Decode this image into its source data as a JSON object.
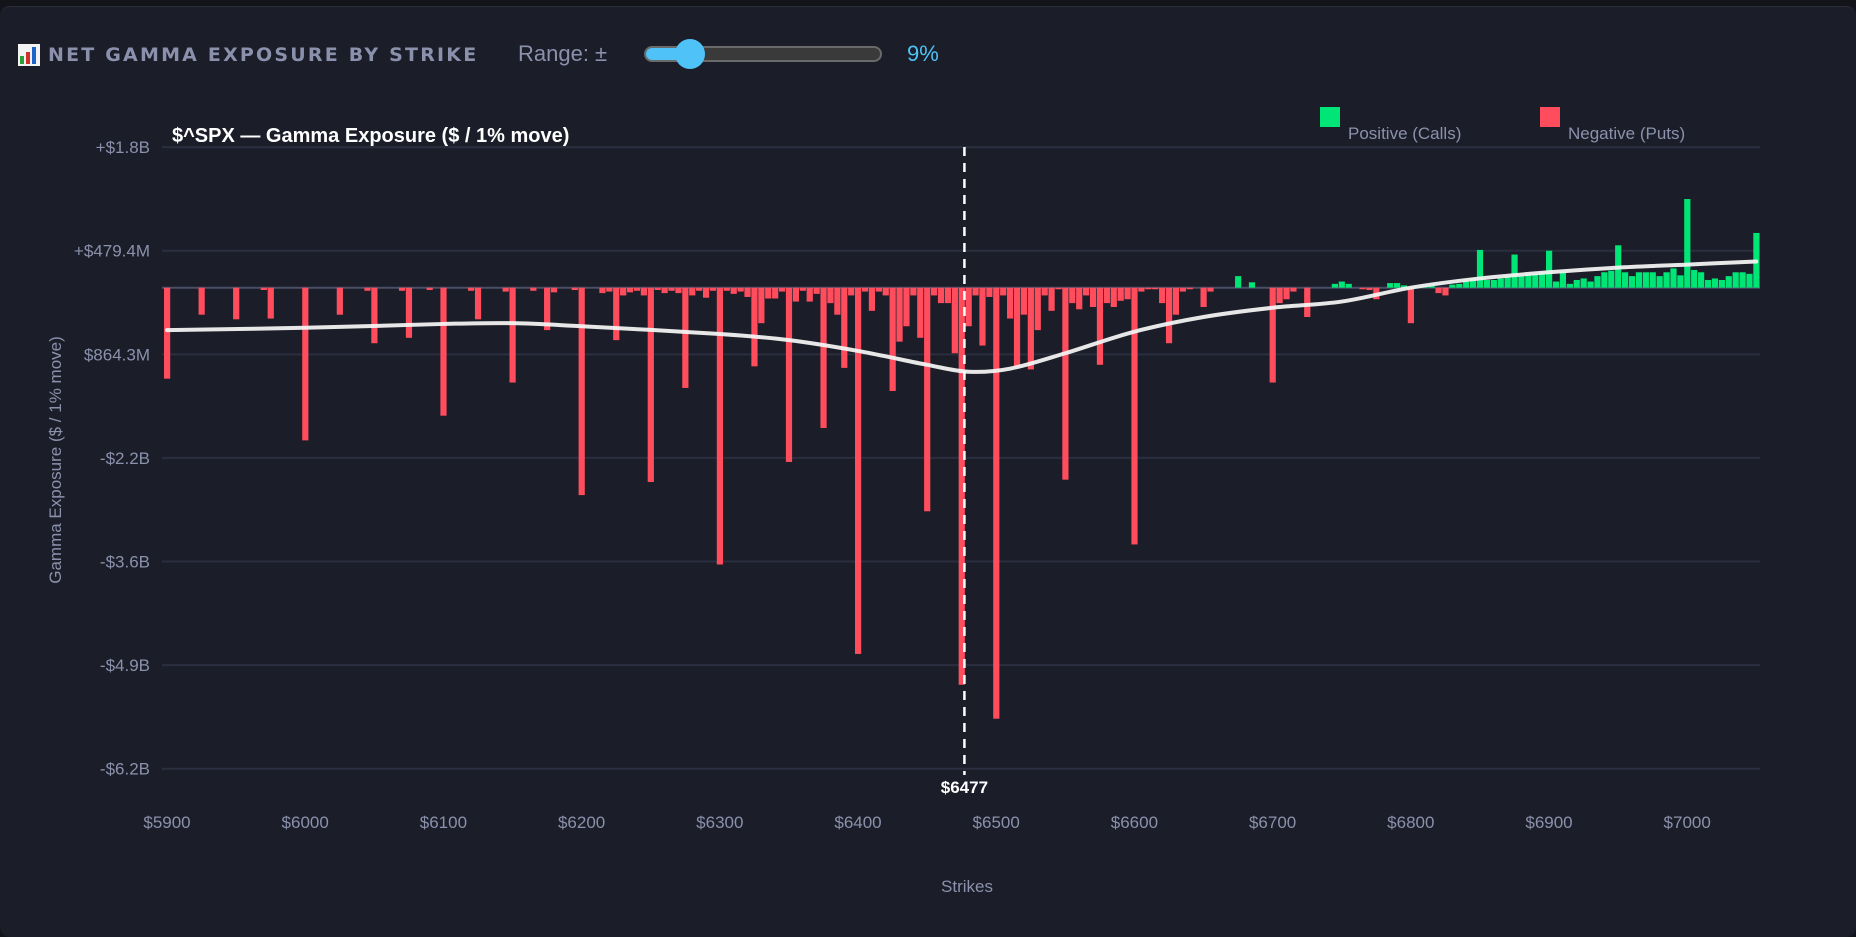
{
  "header": {
    "icon": "bar-chart-icon",
    "title": "NET GAMMA EXPOSURE BY STRIKE",
    "range_label": "Range: ±",
    "range_value_text": "9%",
    "range_value": 9,
    "slider_fill_fraction": 0.19
  },
  "colors": {
    "positive": "#00e676",
    "negative": "#ff4d5e",
    "trend": "#f2f2f2",
    "accent": "#4fc3f7",
    "background": "#1b1e28"
  },
  "chart_data": {
    "type": "bar",
    "title": "$^SPX — Gamma Exposure ($ / 1% move)",
    "xlabel": "Strikes",
    "ylabel": "Gamma Exposure ($ / 1% move)",
    "legend": [
      {
        "name": "Positive (Calls)",
        "color": "#00e676"
      },
      {
        "name": "Negative (Puts)",
        "color": "#ff4d5e"
      }
    ],
    "legend_position": "top-right",
    "units": "billions USD",
    "strike_start": 5900,
    "strike_step": 5,
    "xlim": [
      5900,
      7050
    ],
    "ylim": [
      -6.239,
      1.823
    ],
    "grid": true,
    "x_ticks": [
      5900,
      6000,
      6100,
      6200,
      6300,
      6400,
      6500,
      6600,
      6700,
      6800,
      6900,
      7000
    ],
    "x_tick_labels": [
      "$5900",
      "$6000",
      "$6100",
      "$6200",
      "$6300",
      "$6400",
      "$6500",
      "$6600",
      "$6700",
      "$6800",
      "$6900",
      "$7000"
    ],
    "y_ticks": [
      1.823,
      0.4794,
      -0.8643,
      -2.208,
      -3.552,
      -4.895,
      -6.239
    ],
    "y_tick_labels": [
      "+$1.8B",
      "+$479.4M",
      "$864.3M",
      "-$2.2B",
      "-$3.6B",
      "-$4.9B",
      "-$6.2B"
    ],
    "spot": {
      "value": 6477,
      "label": "$6477"
    },
    "values": [
      -1.18,
      0,
      0,
      0,
      0,
      -0.35,
      0,
      0,
      0,
      0,
      -0.41,
      0,
      0,
      0,
      -0.03,
      -0.4,
      0,
      0,
      0,
      0,
      -1.98,
      0,
      0,
      0,
      0,
      -0.35,
      0,
      0,
      0,
      -0.04,
      -0.72,
      0,
      0,
      0,
      -0.04,
      -0.65,
      0,
      0,
      -0.03,
      0,
      -1.66,
      0,
      0,
      0,
      -0.04,
      -0.41,
      0,
      0,
      0,
      -0.05,
      -1.23,
      0,
      0,
      -0.04,
      0,
      -0.55,
      -0.06,
      0,
      0,
      -0.03,
      -2.69,
      0,
      0,
      -0.07,
      -0.05,
      -0.68,
      -0.1,
      -0.06,
      -0.04,
      -0.1,
      -2.52,
      -0.03,
      -0.07,
      -0.04,
      -0.07,
      -1.3,
      -0.1,
      -0.04,
      -0.13,
      -0.04,
      -3.59,
      -0.04,
      -0.08,
      -0.05,
      -0.12,
      -1.02,
      -0.46,
      -0.14,
      -0.14,
      -0.05,
      -2.26,
      -0.18,
      -0.04,
      -0.18,
      -0.08,
      -1.82,
      -0.2,
      -0.35,
      -1.04,
      -0.1,
      -4.75,
      -0.05,
      -0.3,
      -0.05,
      -0.1,
      -1.34,
      -0.7,
      -0.5,
      -0.1,
      -0.65,
      -2.9,
      -0.1,
      -0.2,
      -0.2,
      -0.85,
      -5.15,
      -0.5,
      -0.1,
      -0.75,
      -0.12,
      -5.59,
      -0.1,
      -0.4,
      -1.02,
      -0.35,
      -1.06,
      -0.55,
      -0.1,
      -0.3,
      -0.02,
      -2.49,
      -0.2,
      -0.28,
      -0.1,
      -0.25,
      -1.0,
      -0.2,
      -0.25,
      -0.17,
      -0.15,
      -3.33,
      -0.05,
      -0.02,
      -0.02,
      -0.2,
      -0.72,
      -0.35,
      -0.05,
      -0.02,
      0,
      -0.25,
      -0.05,
      0,
      0,
      0,
      0.15,
      0,
      0.07,
      0,
      0,
      -1.23,
      -0.2,
      -0.15,
      -0.05,
      0,
      -0.38,
      0,
      0,
      0,
      0.05,
      0.08,
      0.05,
      0,
      -0.02,
      -0.03,
      -0.15,
      0,
      0.06,
      0.06,
      0.03,
      -0.46,
      0,
      0.03,
      0.03,
      -0.07,
      -0.1,
      0.04,
      0.05,
      0.08,
      0.12,
      0.49,
      0.1,
      0.1,
      0.12,
      0.15,
      0.43,
      0.15,
      0.18,
      0.18,
      0.2,
      0.48,
      0.08,
      0.2,
      0.05,
      0.1,
      0.12,
      0.08,
      0.15,
      0.2,
      0.22,
      0.55,
      0.2,
      0.15,
      0.2,
      0.2,
      0.2,
      0.15,
      0.2,
      0.25,
      0.16,
      1.15,
      0.23,
      0.2,
      0.1,
      0.12,
      0.1,
      0.15,
      0.2,
      0.2,
      0.18,
      0.71
    ],
    "trend": [
      [
        5900,
        -0.55
      ],
      [
        6000,
        -0.52
      ],
      [
        6100,
        -0.47
      ],
      [
        6150,
        -0.46
      ],
      [
        6200,
        -0.5
      ],
      [
        6300,
        -0.6
      ],
      [
        6350,
        -0.68
      ],
      [
        6400,
        -0.82
      ],
      [
        6450,
        -1.0
      ],
      [
        6480,
        -1.09
      ],
      [
        6510,
        -1.05
      ],
      [
        6550,
        -0.85
      ],
      [
        6600,
        -0.57
      ],
      [
        6650,
        -0.38
      ],
      [
        6700,
        -0.26
      ],
      [
        6750,
        -0.18
      ],
      [
        6800,
        0.0
      ],
      [
        6850,
        0.12
      ],
      [
        6900,
        0.2
      ],
      [
        6950,
        0.26
      ],
      [
        7000,
        0.3
      ],
      [
        7050,
        0.34
      ]
    ]
  }
}
